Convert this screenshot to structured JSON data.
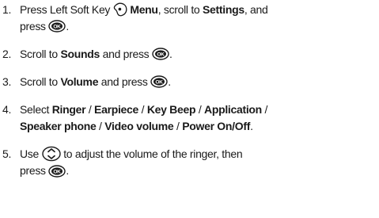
{
  "steps": [
    {
      "num": "1.",
      "p1": "Press Left Soft Key",
      "menu": "Menu",
      "p2": ", scroll to",
      "settings": "Settings",
      "p3": ", and",
      "p4": "press",
      "end": "."
    },
    {
      "num": "2.",
      "p1": "Scroll to",
      "sounds": "Sounds",
      "p2": "and press",
      "end": "."
    },
    {
      "num": "3.",
      "p1": "Scroll to",
      "volume": "Volume",
      "p2": "and press",
      "end": "."
    },
    {
      "num": "4.",
      "p1": "Select",
      "ringer": "Ringer",
      "earpiece": "Earpiece",
      "keybeep": "Key Beep",
      "application": "Application",
      "speaker": "Speaker phone",
      "video": "Video volume",
      "power": "Power On/Off",
      "sep": " / ",
      "end": "."
    },
    {
      "num": "5.",
      "p1": "Use",
      "p2": "to adjust the volume of the ringer, then",
      "p3": "press",
      "end": "."
    }
  ],
  "icons": {
    "ok_label": "OK",
    "ok_color": "#1a1a1a",
    "soft_key": "left-soft-key-icon",
    "ok_key": "ok-key-icon",
    "nav_key": "nav-key-icon"
  }
}
